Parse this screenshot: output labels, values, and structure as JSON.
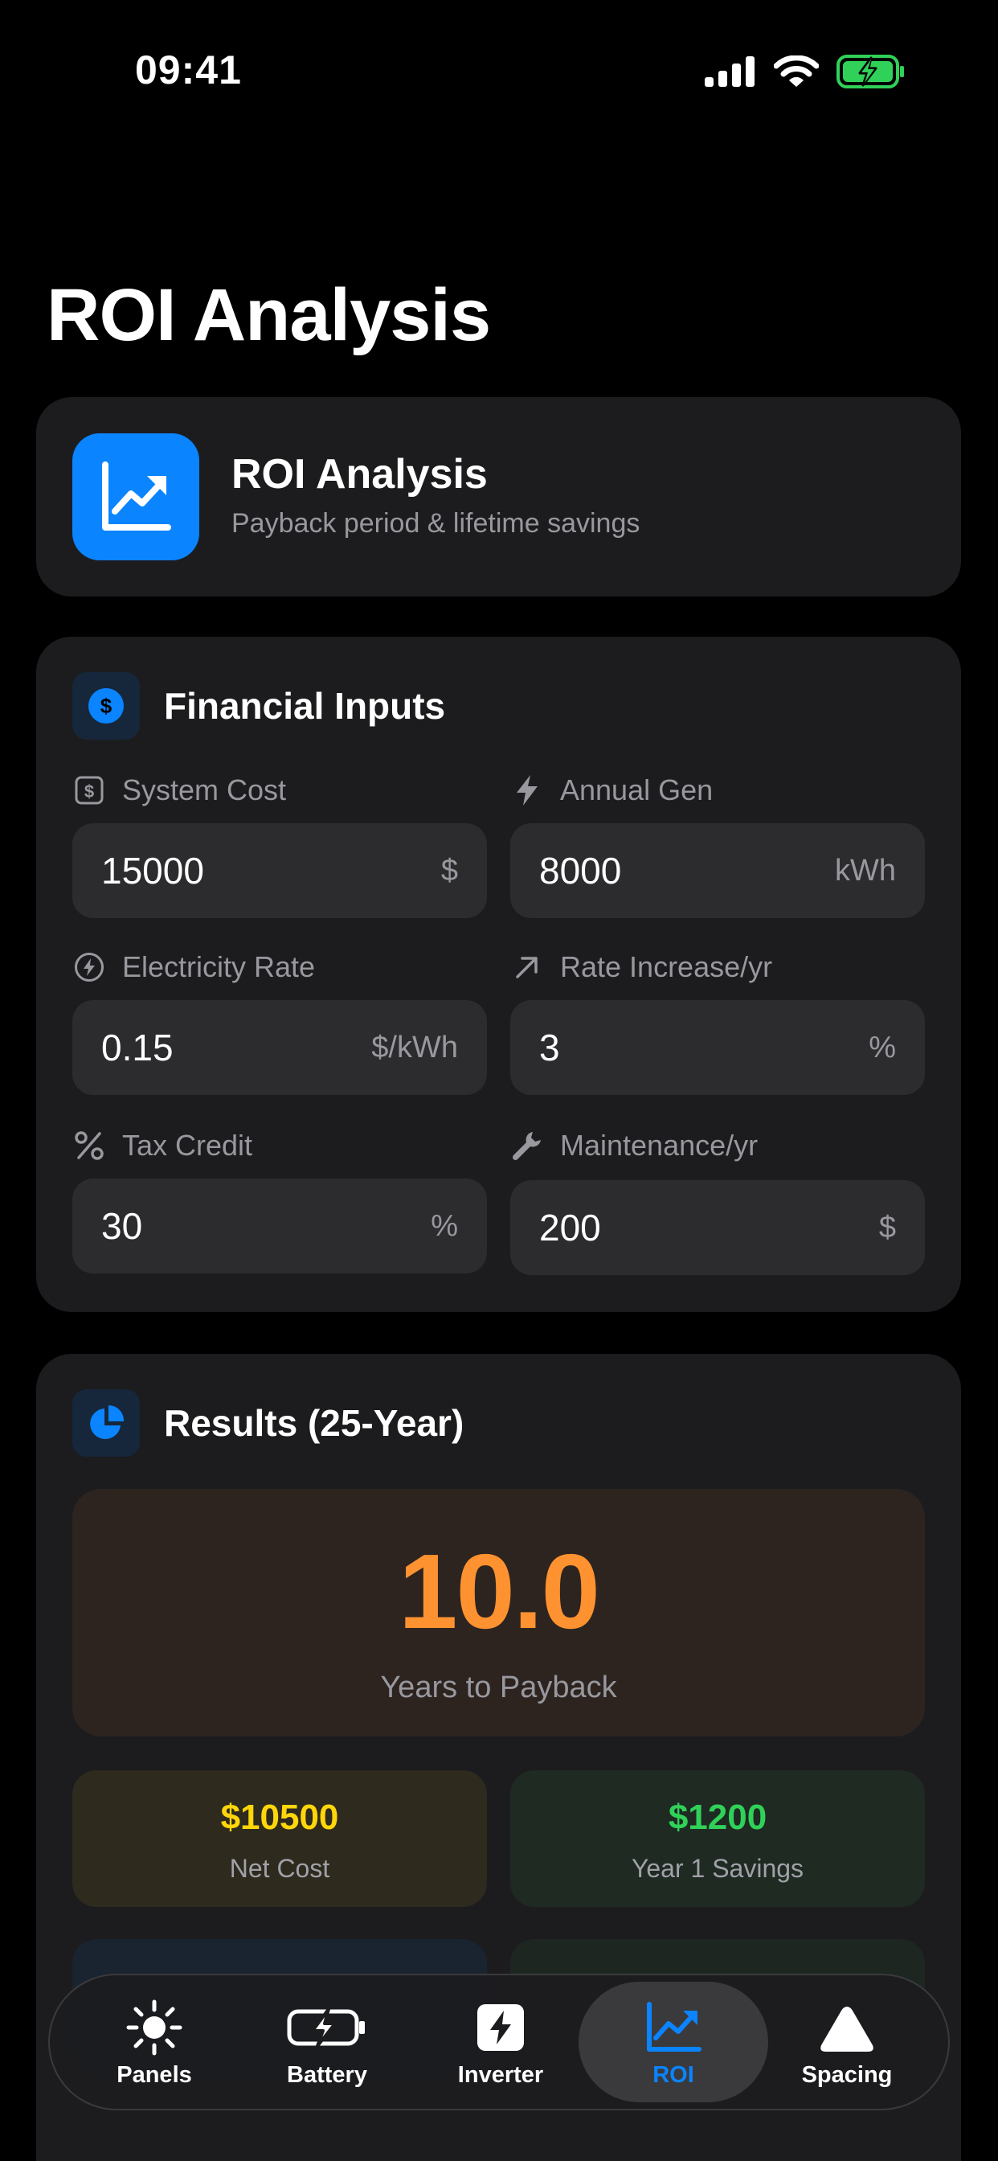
{
  "status": {
    "time": "09:41"
  },
  "page": {
    "title": "ROI Analysis"
  },
  "header_card": {
    "title": "ROI Analysis",
    "subtitle": "Payback period & lifetime savings",
    "icon": "chart-line-up-icon"
  },
  "inputs": {
    "title": "Financial Inputs",
    "fields": [
      {
        "label": "System Cost",
        "value": "15000",
        "unit": "$",
        "icon": "dollar-square-icon"
      },
      {
        "label": "Annual Gen",
        "value": "8000",
        "unit": "kWh",
        "icon": "bolt-icon"
      },
      {
        "label": "Electricity Rate",
        "value": "0.15",
        "unit": "$/kWh",
        "icon": "bolt-circle-icon"
      },
      {
        "label": "Rate Increase/yr",
        "value": "3",
        "unit": "%",
        "icon": "arrow-up-right-icon"
      },
      {
        "label": "Tax Credit",
        "value": "30",
        "unit": "%",
        "icon": "percent-icon"
      },
      {
        "label": "Maintenance/yr",
        "value": "200",
        "unit": "$",
        "icon": "wrench-icon"
      }
    ]
  },
  "results": {
    "title": "Results (25-Year)",
    "payback_value": "10.0",
    "payback_label": "Years to Payback",
    "stats": [
      {
        "value": "$10500",
        "label": "Net Cost",
        "color": "#ffd60a"
      },
      {
        "value": "$1200",
        "label": "Year 1 Savings",
        "color": "#30d158"
      }
    ]
  },
  "tabs": [
    {
      "label": "Panels",
      "icon": "sun-icon"
    },
    {
      "label": "Battery",
      "icon": "battery-charging-icon"
    },
    {
      "label": "Inverter",
      "icon": "bolt-square-icon"
    },
    {
      "label": "ROI",
      "icon": "chart-line-up-icon",
      "active": true
    },
    {
      "label": "Spacing",
      "icon": "triangle-icon"
    }
  ],
  "colors": {
    "accent": "#0a84ff",
    "payback": "#ff9230",
    "card": "#1c1c1e",
    "field": "#2c2c2e"
  }
}
